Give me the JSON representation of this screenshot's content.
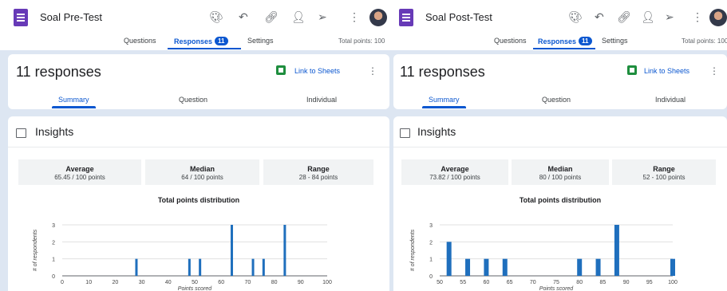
{
  "panels": [
    {
      "form_title": "Soal Pre-Test",
      "tabs": {
        "questions": "Questions",
        "responses": "Responses",
        "responses_count": "11",
        "settings": "Settings"
      },
      "total_points": "Total points: 100",
      "responses_title": "11 responses",
      "link_to_sheets": "Link to Sheets",
      "subtabs": {
        "summary": "Summary",
        "question": "Question",
        "individual": "Individual"
      },
      "insights_title": "Insights",
      "stats": [
        {
          "label": "Average",
          "value": "65.45 / 100 points"
        },
        {
          "label": "Median",
          "value": "64 / 100 points"
        },
        {
          "label": "Range",
          "value": "28 - 84 points"
        }
      ],
      "icons": [
        "forms-icon",
        "palette-icon",
        "undo-icon",
        "link-icon",
        "add-collaborator-icon",
        "send-icon",
        "more-vert-icon",
        "avatar",
        "sheets-icon",
        "insights-icon"
      ],
      "accent_color": "#0b57d0",
      "bar_color": "#1f6fbd",
      "chart_data": {
        "type": "bar",
        "title": "Total points distribution",
        "xlabel": "Points scored",
        "ylabel": "# of respondents",
        "xlim": [
          0,
          100
        ],
        "ylim": [
          0,
          3
        ],
        "xticks": [
          0,
          10,
          20,
          30,
          40,
          50,
          60,
          70,
          80,
          90,
          100
        ],
        "yticks": [
          0,
          1,
          2,
          3
        ],
        "x": [
          28,
          48,
          52,
          64,
          72,
          76,
          84
        ],
        "values": [
          1,
          1,
          1,
          3,
          1,
          1,
          3
        ]
      }
    },
    {
      "form_title": "Soal Post-Test",
      "tabs": {
        "questions": "Questions",
        "responses": "Responses",
        "responses_count": "11",
        "settings": "Settings"
      },
      "total_points": "Total points: 100",
      "responses_title": "11 responses",
      "link_to_sheets": "Link to Sheets",
      "subtabs": {
        "summary": "Summary",
        "question": "Question",
        "individual": "Individual"
      },
      "insights_title": "Insights",
      "stats": [
        {
          "label": "Average",
          "value": "73.82 / 100 points"
        },
        {
          "label": "Median",
          "value": "80 / 100 points"
        },
        {
          "label": "Range",
          "value": "52 - 100 points"
        }
      ],
      "icons": [
        "forms-icon",
        "palette-icon",
        "undo-icon",
        "link-icon",
        "add-collaborator-icon",
        "send-icon",
        "more-vert-icon",
        "avatar",
        "sheets-icon",
        "insights-icon"
      ],
      "accent_color": "#0b57d0",
      "bar_color": "#1f6fbd",
      "chart_data": {
        "type": "bar",
        "title": "Total points distribution",
        "xlabel": "Points scored",
        "ylabel": "# of respondents",
        "xlim": [
          50,
          100
        ],
        "ylim": [
          0,
          3
        ],
        "xticks": [
          50,
          55,
          60,
          65,
          70,
          75,
          80,
          85,
          90,
          95,
          100
        ],
        "yticks": [
          0,
          1,
          2,
          3
        ],
        "x": [
          52,
          56,
          60,
          64,
          80,
          84,
          88,
          100
        ],
        "values": [
          2,
          1,
          1,
          1,
          1,
          1,
          3,
          1
        ]
      }
    }
  ]
}
